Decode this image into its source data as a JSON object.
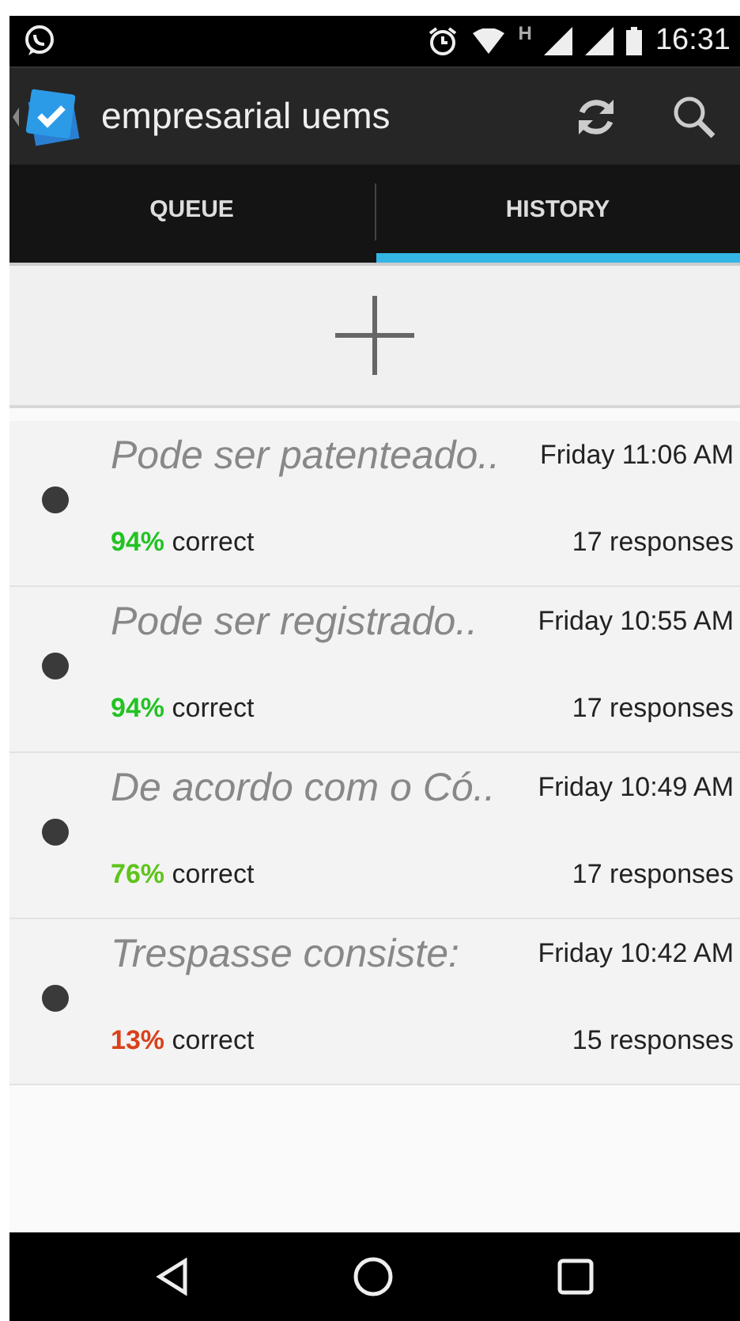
{
  "status_bar": {
    "time": "16:31",
    "network": "H"
  },
  "app_bar": {
    "title": "empresarial uems"
  },
  "tabs": [
    {
      "label": "QUEUE",
      "selected": false
    },
    {
      "label": "HISTORY",
      "selected": true
    }
  ],
  "history": [
    {
      "title": "Pode ser patenteado..",
      "time": "Friday 11:06 AM",
      "percent": "94%",
      "color": "#22c322",
      "suffix": "correct",
      "responses": "17 responses"
    },
    {
      "title": "Pode ser registrado..",
      "time": "Friday 10:55 AM",
      "percent": "94%",
      "color": "#22c322",
      "suffix": "correct",
      "responses": "17 responses"
    },
    {
      "title": "De acordo com o Có..",
      "time": "Friday 10:49 AM",
      "percent": "76%",
      "color": "#5ec41a",
      "suffix": "correct",
      "responses": "17 responses"
    },
    {
      "title": "Trespasse consiste:",
      "time": "Friday 10:42 AM",
      "percent": "13%",
      "color": "#d9411a",
      "suffix": "correct",
      "responses": "15 responses"
    }
  ]
}
